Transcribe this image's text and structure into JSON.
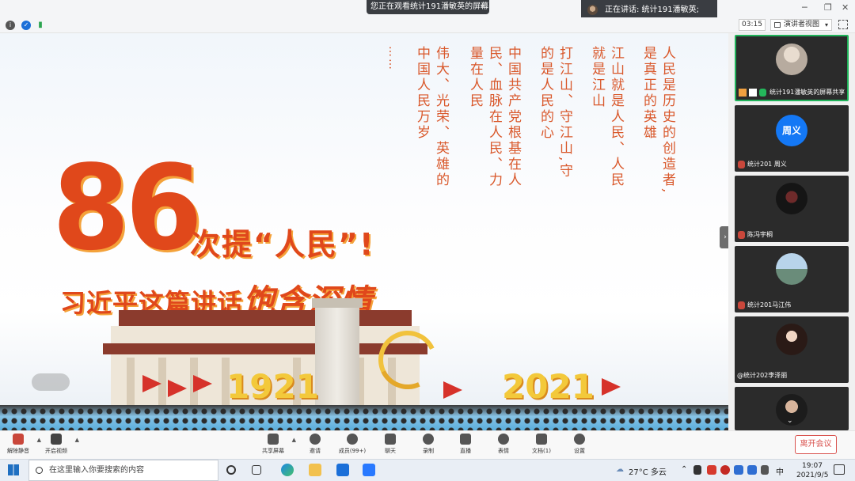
{
  "topbar": {
    "watching_text": "您正在观看统计191潘敏英的屏幕",
    "speaking_text": "正在讲话: 统计191潘敏英;"
  },
  "status": {
    "timer": "03:15",
    "view_mode": "演讲者视图"
  },
  "slide": {
    "poem_columns": [
      "人民是历史的创造者,",
      "是真正的英雄",
      "江山就是人民、人民",
      "就是江山",
      "打江山、守江山,守",
      "的是人民的心",
      "中国共产党根基在人",
      "民、血脉在人民、力",
      "量在人民",
      "伟大、光荣、英雄的",
      "中国人民万岁"
    ],
    "ellipsis": "……",
    "big_number": "86",
    "headline_line1": "次提“人民”!",
    "headline_line2_plain": "习近平这篇讲话",
    "headline_line2_script": "饱含深情",
    "year_start": "1921",
    "year_end": "2021"
  },
  "gallery": {
    "participants": [
      {
        "name": "统计191潘敏英的屏幕共享",
        "active": true
      },
      {
        "name": "统计201 周义",
        "initials": "周义"
      },
      {
        "name": "陈冯宇桐"
      },
      {
        "name": "统计201马江伟"
      },
      {
        "name": "@统计202李泽丽"
      },
      {
        "name": ""
      }
    ]
  },
  "toolbar": {
    "unmute": "解除静音",
    "start_video": "开启视频",
    "share_screen": "共享屏幕",
    "invite": "邀请",
    "members": "成员(99+)",
    "chat": "聊天",
    "record": "录制",
    "live": "直播",
    "reactions": "表情",
    "docs": "文档(1)",
    "settings": "设置",
    "leave": "离开会议"
  },
  "taskbar": {
    "search_placeholder": "在这里输入你要搜索的内容",
    "weather": "27°C 多云",
    "ime": "中",
    "time": "19:07",
    "date": "2021/9/5"
  },
  "colors": {
    "accent_red": "#e0481b",
    "gold": "#f3c93b",
    "active_green": "#20b35a",
    "leave_red": "#d9534f"
  }
}
